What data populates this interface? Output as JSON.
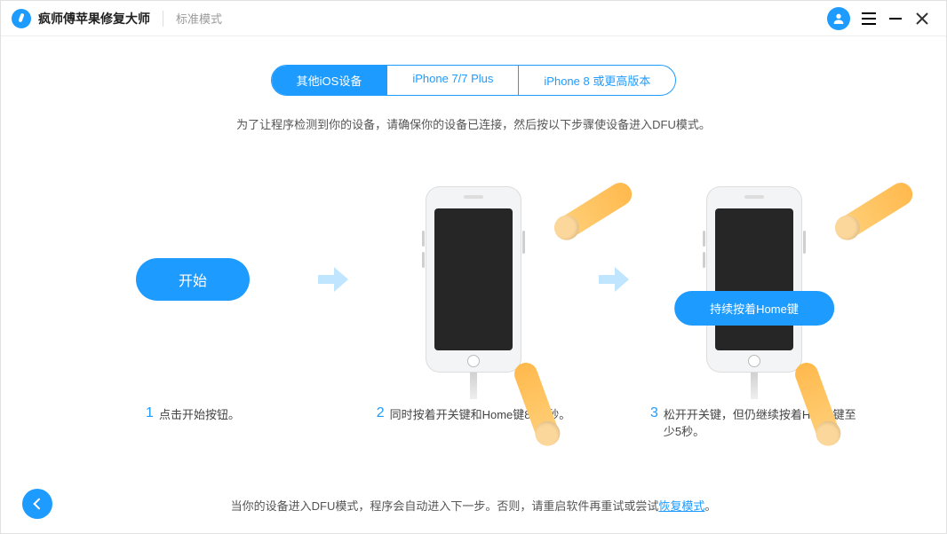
{
  "header": {
    "app_title": "疯师傅苹果修复大师",
    "mode": "标准模式",
    "icons": {
      "user": "user-icon",
      "menu": "menu-icon",
      "minimize": "minimize-icon",
      "close": "close-icon"
    }
  },
  "tabs": [
    {
      "label": "其他iOS设备",
      "active": true
    },
    {
      "label": "iPhone 7/7 Plus",
      "active": false
    },
    {
      "label": "iPhone 8 或更高版本",
      "active": false
    }
  ],
  "instruction": "为了让程序检测到你的设备，请确保你的设备已连接，然后按以下步骤使设备进入DFU模式。",
  "steps": {
    "start_label": "开始",
    "hold_label": "持续按着Home键",
    "items": [
      {
        "num": "1",
        "text": "点击开始按钮。"
      },
      {
        "num": "2",
        "text": "同时按着开关键和Home键8-10秒。"
      },
      {
        "num": "3",
        "text": "松开开关键，但仍继续按着Home键至少5秒。"
      }
    ]
  },
  "footer": {
    "text_before": "当你的设备进入DFU模式，程序会自动进入下一步。否则，请重启软件再重试或尝试",
    "link": "恢复模式",
    "text_after": "。"
  }
}
